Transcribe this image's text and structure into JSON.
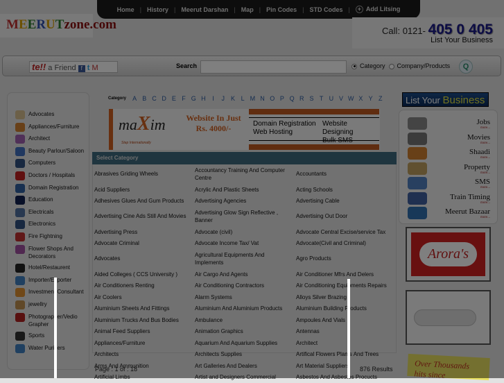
{
  "nav": {
    "items": [
      "Home",
      "History",
      "Meerut Darshan",
      "Map",
      "Pin Codes",
      "STD Codes"
    ],
    "add_listing": "Add Litsing"
  },
  "logo": "MEERUTzone.com",
  "call": {
    "label": "Call:",
    "prefix": "0121-",
    "number": "405 0 405",
    "list": "List Your Business"
  },
  "search": {
    "tell_friend": "a Friend",
    "label": "Search",
    "value": "",
    "options": [
      "Category",
      "Company/Products"
    ],
    "selected": "Category"
  },
  "sidebar": [
    "Advocates",
    "Appliances/Furniture",
    "Architect",
    "Beauty Parlour/Saloon",
    "Computers",
    "Doctors / Hospitals",
    "Domain Registration",
    "Education",
    "Electricals",
    "Electronics",
    "Fire Fightning",
    "Flower Shops And Decorators",
    "Hotel/Restaurent",
    "Importer/Exporter",
    "Investment Consultant",
    "jewellry",
    "Photographer/Vedio Grapher",
    "Sports",
    "Water Purifiers"
  ],
  "alphabet": {
    "label": "Category",
    "letters": [
      "A",
      "B",
      "C",
      "D",
      "E",
      "F",
      "G",
      "H",
      "I",
      "J",
      "K",
      "L",
      "M",
      "N",
      "O",
      "P",
      "Q",
      "R",
      "S",
      "T",
      "U",
      "V",
      "W",
      "X",
      "Y",
      "Z"
    ]
  },
  "banner": {
    "brand": "maxim",
    "tagline": "Step Internationally",
    "offer": "Website In Just Rs. 4000/-",
    "services": [
      "Domain Registration",
      "Web Hosting",
      "Website Designing",
      "Bulk SMS"
    ]
  },
  "grid": {
    "header": "Select Category",
    "rows": [
      [
        "Abrasives Griding Wheels",
        "Accountancy Training And Computer Centre",
        "Accountants"
      ],
      [
        "Acid Suppliers",
        "Acrylic And Plastic Sheets",
        "Acting Schools"
      ],
      [
        "Adhesives Glues And Gum Products",
        "Advertising Agencies",
        "Advertising Cable"
      ],
      [
        "Advertising Cine Ads Still And Movies",
        "Advertising Glow Sign Reflective , Banner",
        "Advertising Out Door"
      ],
      [
        "Advertising Press",
        "Advocate (civil)",
        "Advocate Central Excise/service Tax"
      ],
      [
        "Advocate Criminal",
        "Advocate Income Tax/ Vat",
        "Advocate(Civil and Criminal)"
      ],
      [
        "Advocates",
        "Agricultural Equipments And Implements",
        "Agro Products"
      ],
      [
        "Aided Colleges ( CCS University )",
        "Air Cargo And Agents",
        "Air Conditioner Mfrs And Delers"
      ],
      [
        "Air Conditioners Renting",
        "Air Conditioning Contractors",
        "Air Conditioning Equipments Repairs"
      ],
      [
        "Air Coolers",
        "Alarm Systems",
        "Alloys Silver Brazing"
      ],
      [
        "Aluminium Sheets And Fittings",
        "Aluminium And Aluminium Products",
        "Aluminium Building Products"
      ],
      [
        "Aluminium Trucks And Bus Bodies",
        "Ambulance",
        "Ampoules And Vials"
      ],
      [
        "Animal Feed Suppliers",
        "Animation Graphics",
        "Antennas"
      ],
      [
        "Appliances/Furniture",
        "Aquarium And Aquarium Supplies",
        "Architect"
      ],
      [
        "Architects",
        "Architects Supplies",
        "Artifical Flowers Plants And Trees"
      ],
      [
        "Arms And Ammunition",
        "Art Galleries And Dealers",
        "Art Material Suppliers"
      ],
      [
        "Artificial Limbs",
        "Artist and Designers Commercial",
        "Asbestos And Asbestos Procucts"
      ]
    ]
  },
  "pagination": {
    "page": "Page : 1 of : 18",
    "results": "876 Results"
  },
  "right": {
    "list_your": "List Your",
    "business": "Business",
    "more": "more...",
    "links": [
      "Jobs",
      "Movies",
      "Shaadi",
      "Property",
      "SMS",
      "Train Timing",
      "Meerut Bazaar"
    ],
    "ad1": "Arora's",
    "ad3": "Over Thousands hits since"
  }
}
